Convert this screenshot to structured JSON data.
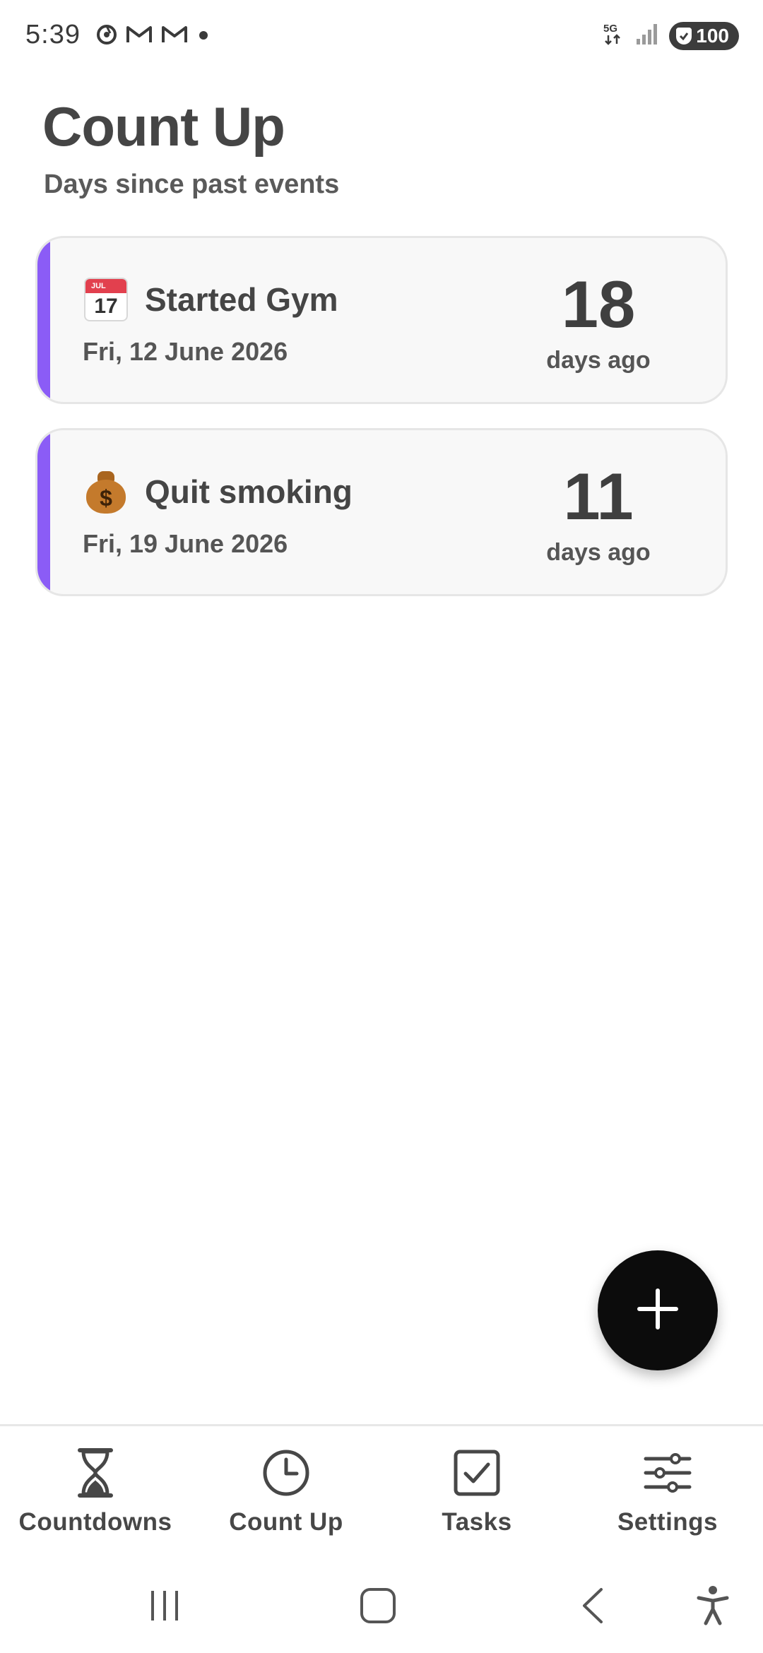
{
  "status_bar": {
    "time": "5:39",
    "network": "5G",
    "battery": "100"
  },
  "header": {
    "title": "Count Up",
    "subtitle": "Days since past events"
  },
  "events": [
    {
      "icon": "calendar-icon",
      "calendar_month": "JUL",
      "calendar_day": "17",
      "title": "Started Gym",
      "date": "Fri, 12 June 2026",
      "count": "18",
      "unit": "days ago",
      "accent_color": "#8b5cf6"
    },
    {
      "icon": "money-bag-icon",
      "bag_symbol": "$",
      "title": "Quit smoking",
      "date": "Fri, 19 June 2026",
      "count": "11",
      "unit": "days ago",
      "accent_color": "#8b5cf6"
    }
  ],
  "fab": {
    "icon": "plus-icon"
  },
  "bottom_nav": {
    "items": [
      {
        "label": "Countdowns",
        "icon": "hourglass-icon"
      },
      {
        "label": "Count Up",
        "icon": "clock-icon",
        "active": true
      },
      {
        "label": "Tasks",
        "icon": "checkbox-icon"
      },
      {
        "label": "Settings",
        "icon": "sliders-icon"
      }
    ]
  },
  "colors": {
    "accent": "#8b5cf6",
    "fab_background": "#0c0c0c",
    "card_background": "#f8f8f8",
    "text_primary": "#454545"
  }
}
